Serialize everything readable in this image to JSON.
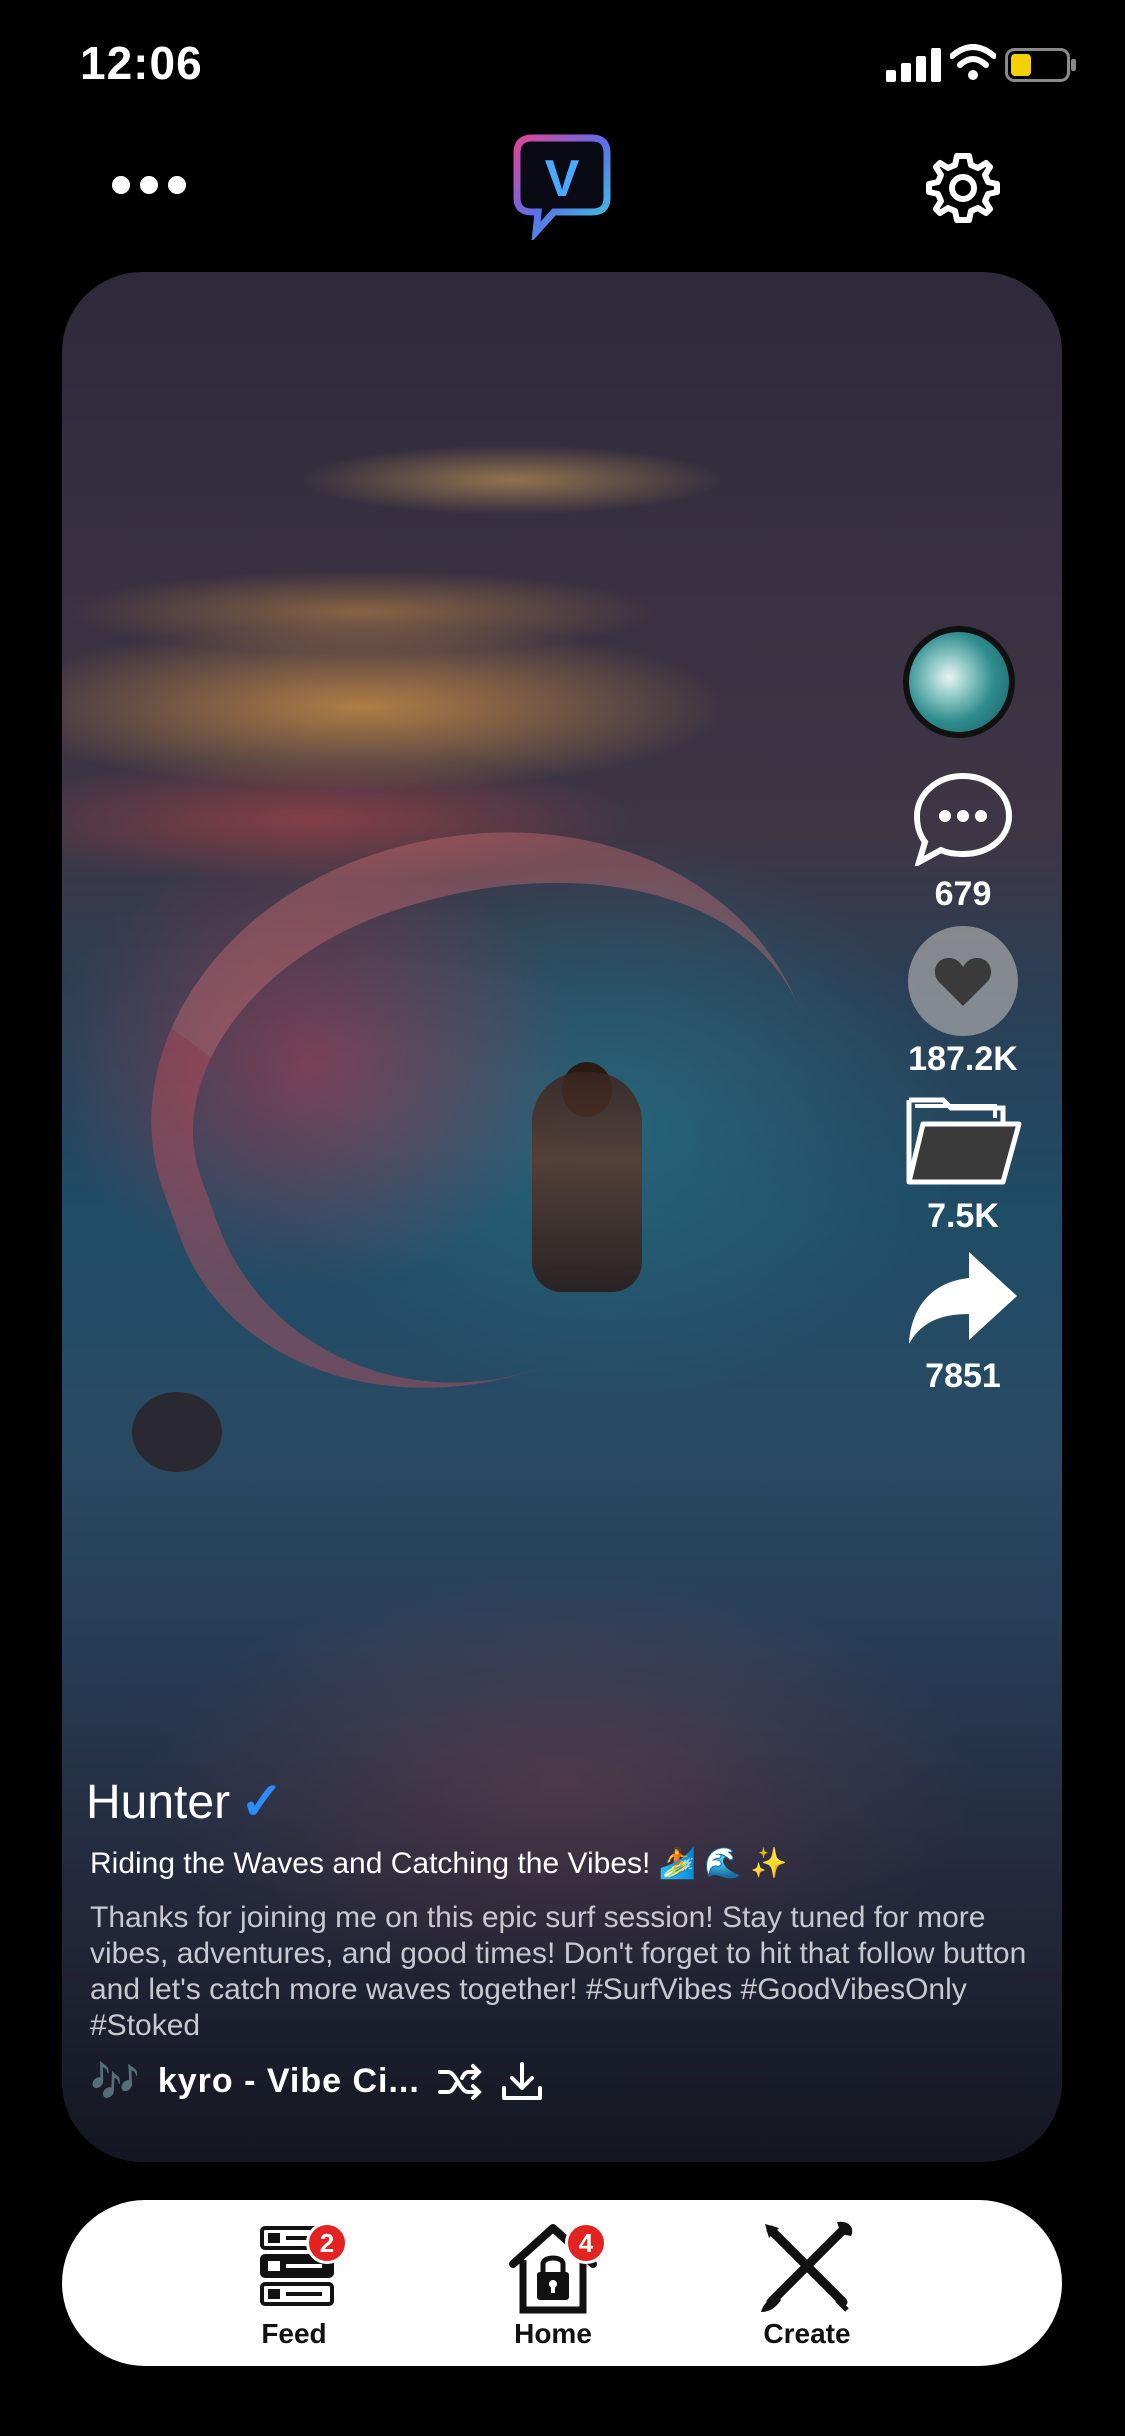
{
  "status_bar": {
    "time": "12:06",
    "icons": [
      "cellular-signal-icon",
      "wifi-icon",
      "battery-low-icon"
    ],
    "battery_color": "#f5d000"
  },
  "top_nav": {
    "left_icon": "more-icon",
    "logo_letter": "V",
    "right_icon": "gear-icon"
  },
  "post": {
    "username": "Hunter",
    "verified_mark": "✓",
    "title": "Riding the Waves and Catching the Vibes! 🏄 🌊 ✨",
    "description": "Thanks for joining me on this epic surf session! Stay tuned for more vibes, adventures, and good times! Don't forget to hit that follow button and let's catch more waves together! #SurfVibes #GoodVibesOnly #Stoked",
    "music": "kyro - Vibe Ci...",
    "music_icon": "🎶"
  },
  "actions": {
    "comments": "679",
    "likes": "187.2K",
    "saves": "7.5K",
    "shares": "7851"
  },
  "tab_bar": {
    "tabs": [
      {
        "label": "Feed",
        "badge": "2"
      },
      {
        "label": "Home",
        "badge": "4"
      },
      {
        "label": "Create",
        "badge": ""
      }
    ]
  },
  "colors": {
    "accent_blue": "#2a8cff",
    "badge_red": "#e32222",
    "background": "#000000"
  }
}
